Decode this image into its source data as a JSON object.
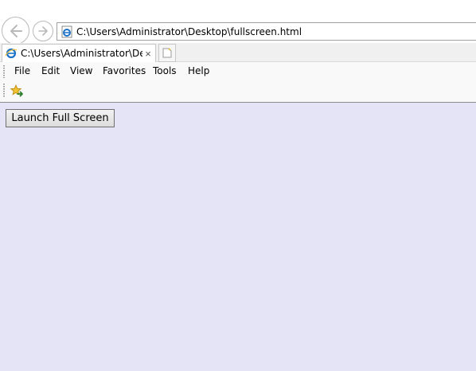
{
  "address_bar": {
    "url": "C:\\Users\\Administrator\\Desktop\\fullscreen.html",
    "icon": "ie-page-icon"
  },
  "nav": {
    "back_icon": "back-arrow-icon",
    "forward_icon": "forward-arrow-icon"
  },
  "tabs": [
    {
      "label": "C:\\Users\\Administrator\\Des...",
      "icon": "ie-page-icon",
      "close": "×"
    }
  ],
  "new_tab_icon": "new-tab-icon",
  "menubar": {
    "items": [
      "File",
      "Edit",
      "View",
      "Favorites",
      "Tools",
      "Help"
    ]
  },
  "favorites_bar": {
    "icon": "add-to-favorites-icon"
  },
  "content": {
    "button_label": "Launch Full Screen",
    "background": "#e4e4f6"
  },
  "colors": {
    "ie_blue": "#1e73c8",
    "nav_grey": "#b9b9b9",
    "star_yellow": "#f2c230"
  }
}
